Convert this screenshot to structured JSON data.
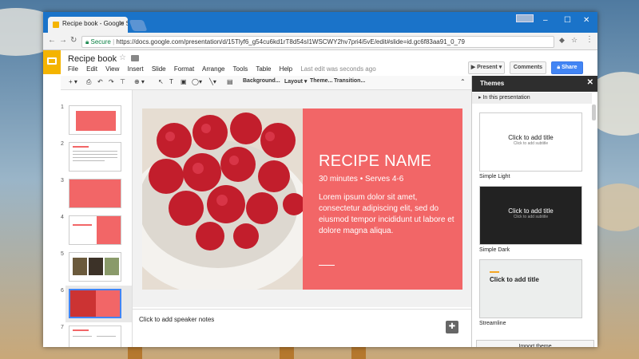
{
  "browser": {
    "tab_title": "Recipe book - Google Sl",
    "secure_label": "Secure",
    "url": "https://docs.google.com/presentation/d/15Tlyf6_g54cu6kd1rT8d54sI1WSCWY2hv7pri4i5vE/edit#slide=id.gc6f83aa91_0_79"
  },
  "doc": {
    "title": "Recipe book",
    "menus": [
      "File",
      "Edit",
      "View",
      "Insert",
      "Slide",
      "Format",
      "Arrange",
      "Tools",
      "Table",
      "Help"
    ],
    "last_edit": "Last edit was seconds ago",
    "present_label": "Present",
    "comments_label": "Comments",
    "share_label": "Share"
  },
  "toolbar": {
    "background_label": "Background...",
    "layout_label": "Layout",
    "theme_label": "Theme...",
    "transition_label": "Transition..."
  },
  "filmstrip": {
    "numbers": [
      "1",
      "2",
      "3",
      "4",
      "5",
      "6",
      "7"
    ],
    "selected_index": 6
  },
  "slide": {
    "title": "RECIPE NAME",
    "subtitle": "30 minutes • Serves 4-6",
    "body": "Lorem ipsum dolor sit amet, consectetur adipiscing elit, sed do eiusmod tempor incididunt ut labore et dolore magna aliqua."
  },
  "notes": {
    "placeholder": "Click to add speaker notes"
  },
  "themes_panel": {
    "header": "Themes",
    "section": "In this presentation",
    "themes": [
      {
        "name": "Simple Light",
        "title": "Click to add title",
        "subtitle": "Click to add subtitle"
      },
      {
        "name": "Simple Dark",
        "title": "Click to add title",
        "subtitle": "Click to add subtitle"
      },
      {
        "name": "Streamline",
        "title": "Click to add title",
        "subtitle": ""
      }
    ],
    "import_label": "Import theme"
  },
  "colors": {
    "slide_accent": "#f26667",
    "brand_yellow": "#f4b400",
    "share_blue": "#4285f4"
  }
}
